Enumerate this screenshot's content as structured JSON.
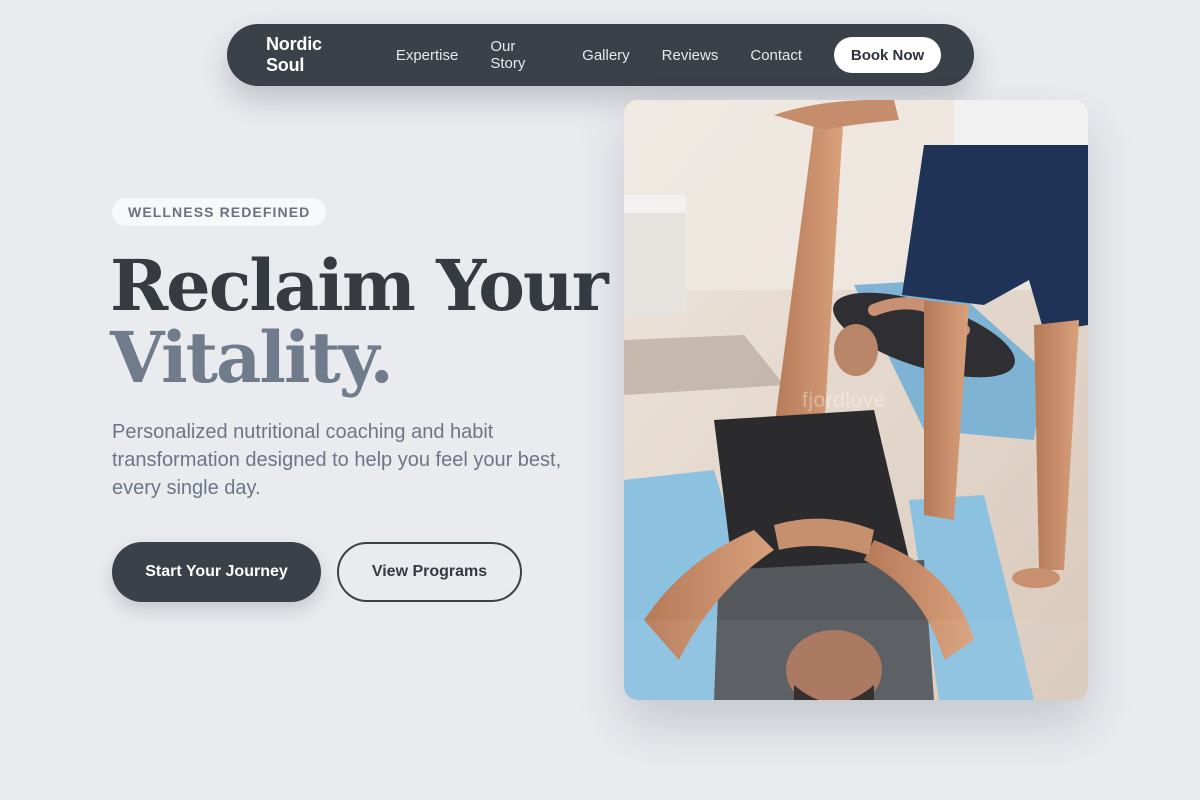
{
  "nav": {
    "brand": "Nordic Soul",
    "links": [
      "Expertise",
      "Our Story",
      "Gallery",
      "Reviews",
      "Contact"
    ],
    "cta": "Book Now"
  },
  "hero": {
    "badge": "WELLNESS REDEFINED",
    "title_line1": "Reclaim Your",
    "title_line2": "Vitality.",
    "subtitle": "Personalized nutritional coaching and habit transformation designed to help you feel your best, every single day.",
    "primary_button": "Start Your Journey",
    "secondary_button": "View Programs"
  },
  "photo": {
    "watermark": "fjordlove"
  },
  "colors": {
    "background": "#e9ebef",
    "nav_bg": "#3b4148",
    "title_dark": "#353b41",
    "title_accent": "#707b8c",
    "body_text": "#6c7686"
  }
}
